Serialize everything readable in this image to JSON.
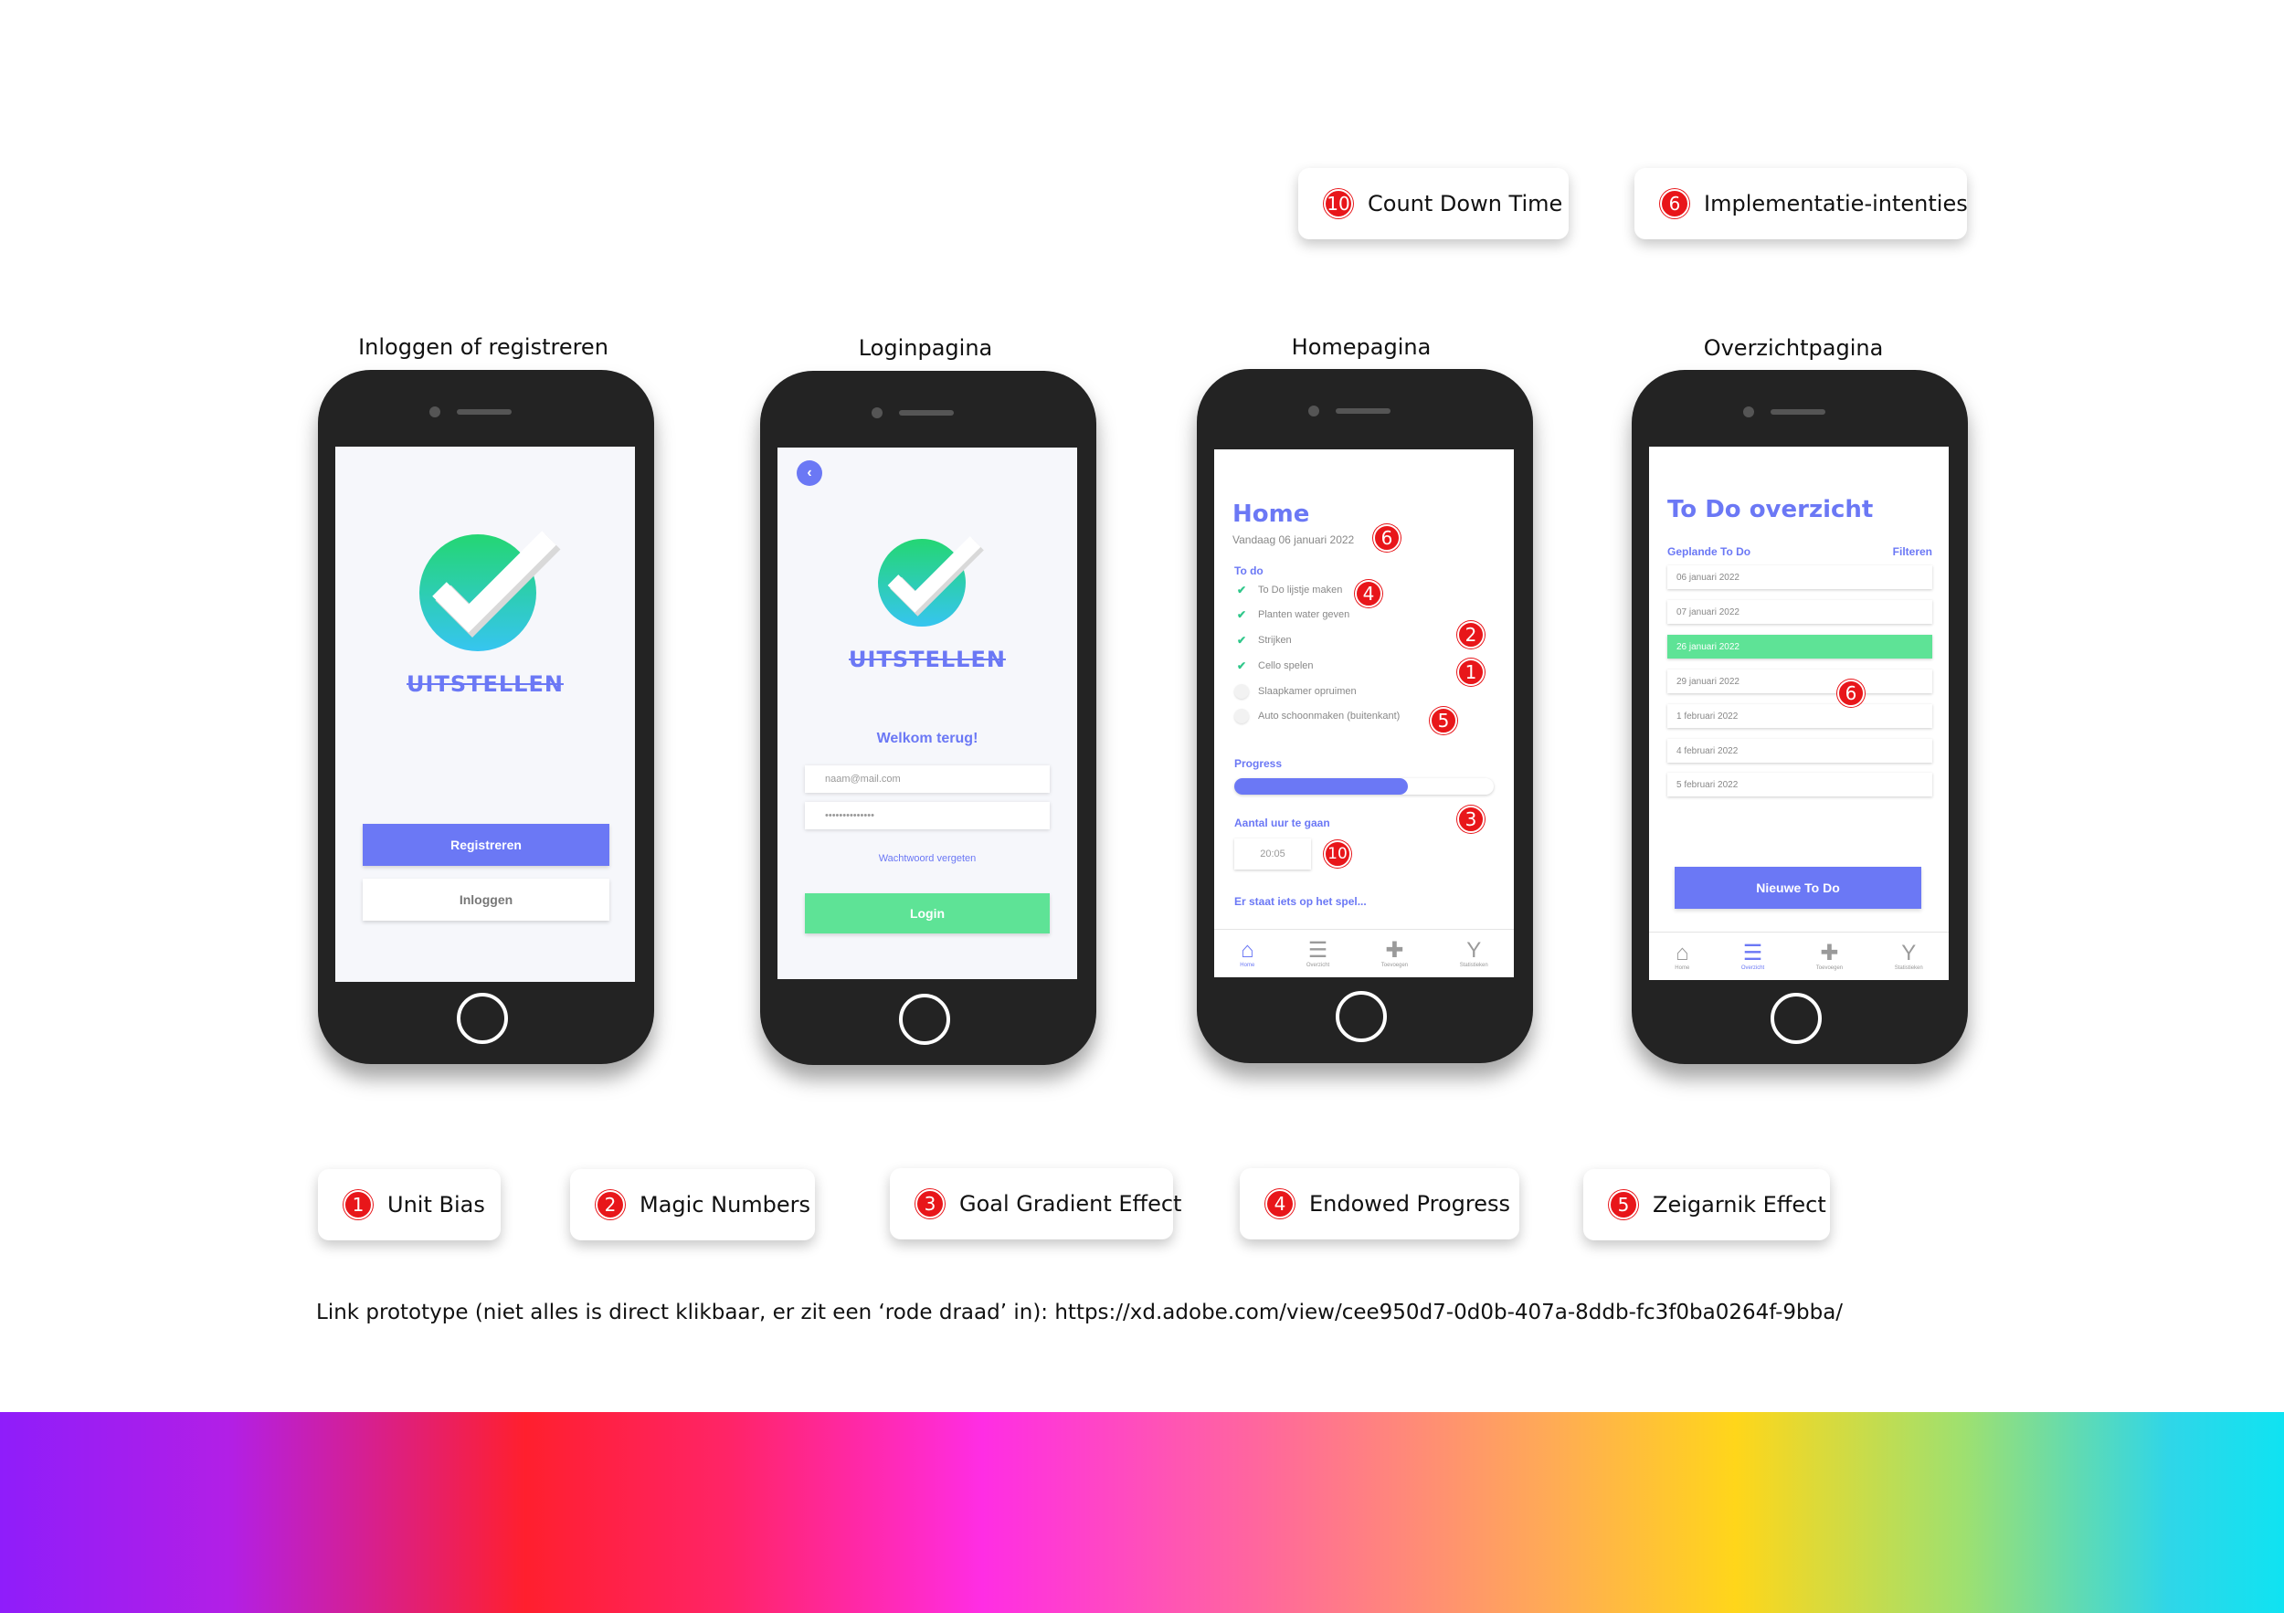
{
  "legend_top": [
    {
      "number": "10",
      "label": "Count Down Time"
    },
    {
      "number": "6",
      "label": "Implementatie-intenties"
    }
  ],
  "legend_bottom": [
    {
      "number": "1",
      "label": "Unit Bias"
    },
    {
      "number": "2",
      "label": "Magic Numbers"
    },
    {
      "number": "3",
      "label": "Goal Gradient Effect"
    },
    {
      "number": "4",
      "label": "Endowed Progress"
    },
    {
      "number": "5",
      "label": "Zeigarnik Effect"
    }
  ],
  "screen_titles": [
    "Inloggen of registreren",
    "Loginpagina",
    "Homepagina",
    "Overzichtpagina"
  ],
  "app": {
    "logo_text": "UITSTELLEN"
  },
  "screen1": {
    "register_button": "Registreren",
    "login_button": "Inloggen"
  },
  "screen2": {
    "welcome": "Welkom terug!",
    "email_placeholder": "naam@mail.com",
    "password_value": "••••••••••••••",
    "forgot_link": "Wachtwoord vergeten",
    "login_button": "Login"
  },
  "screen3": {
    "title": "Home",
    "date": "Vandaag 06 januari 2022",
    "todo_label": "To do",
    "todos": [
      {
        "text": "To Do lijstje maken",
        "done": true
      },
      {
        "text": "Planten water geven",
        "done": true
      },
      {
        "text": "Strijken",
        "done": true
      },
      {
        "text": "Cello spelen",
        "done": true
      },
      {
        "text": "Slaapkamer opruimen",
        "done": false
      },
      {
        "text": "Auto schoonmaken (buitenkant)",
        "done": false
      }
    ],
    "progress_label": "Progress",
    "progress_fraction": 0.67,
    "hours_label": "Aantal uur te gaan",
    "countdown": "20:05",
    "agenda_label": "Er staat iets op het spel..."
  },
  "screen4": {
    "title": "To Do overzicht",
    "planned_label": "Geplande To Do",
    "filter_link": "Filteren",
    "dates": [
      "06 januari 2022",
      "07 januari 2022",
      "26 januari 2022",
      "29 januari 2022",
      "1 februari 2022",
      "4 februari 2022",
      "5 februari 2022"
    ],
    "selected_date": "26 januari 2022",
    "new_button": "Nieuwe To Do"
  },
  "tabbar": [
    "Home",
    "Overzicht",
    "Toevoegen",
    "Statistieken"
  ],
  "annotations": {
    "n1": "1",
    "n2": "2",
    "n3": "3",
    "n4": "4",
    "n5": "5",
    "n6": "6",
    "n10": "10"
  },
  "footer_link": "Link prototype (niet alles is direct klikbaar, er zit een ‘rode draad’ in): https://xd.adobe.com/view/cee950d7-0d0b-407a-8ddb-fc3f0ba0264f-9bba/",
  "colors": {
    "accent": "#6b78f5",
    "green": "#5ee396",
    "badge_red": "#e8161a"
  }
}
